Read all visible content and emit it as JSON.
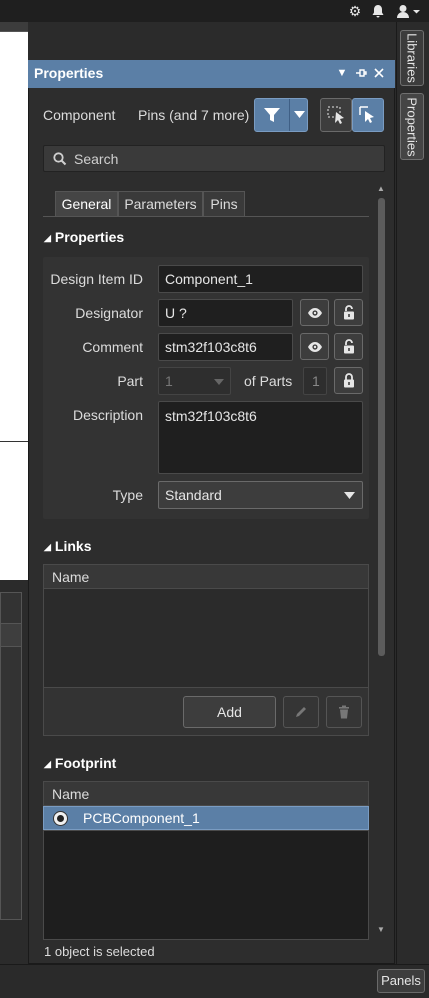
{
  "topbar": {
    "icons": [
      "gear-icon",
      "bell-icon",
      "user-icon"
    ]
  },
  "side_tabs": {
    "libraries": "Libraries",
    "properties": "Properties"
  },
  "panel": {
    "title": "Properties",
    "filter": {
      "left_label": "Component",
      "right_label": "Pins (and 7 more)"
    },
    "search": {
      "placeholder": "Search"
    },
    "tabs": [
      {
        "label": "General",
        "active": true
      },
      {
        "label": "Parameters",
        "active": false
      },
      {
        "label": "Pins",
        "active": false
      }
    ],
    "properties_section": {
      "header": "Properties",
      "design_item_id": {
        "label": "Design Item ID",
        "value": "Component_1"
      },
      "designator": {
        "label": "Designator",
        "value": "U ?"
      },
      "comment": {
        "label": "Comment",
        "value": "stm32f103c8t6"
      },
      "part": {
        "label": "Part",
        "value": "1",
        "of_parts_label": "of Parts",
        "of_parts_value": "1"
      },
      "description": {
        "label": "Description",
        "value": "stm32f103c8t6"
      },
      "type": {
        "label": "Type",
        "value": "Standard"
      }
    },
    "links_section": {
      "header": "Links",
      "column": "Name",
      "add_label": "Add"
    },
    "footprint_section": {
      "header": "Footprint",
      "column": "Name",
      "rows": [
        "PCBComponent_1"
      ]
    },
    "status": "1 object is selected"
  },
  "statusbar": {
    "panels_label": "Panels"
  },
  "colors": {
    "accent": "#5b7fa6",
    "panel_bg": "#2d2d2d",
    "field_bg": "#1f1f1f"
  }
}
